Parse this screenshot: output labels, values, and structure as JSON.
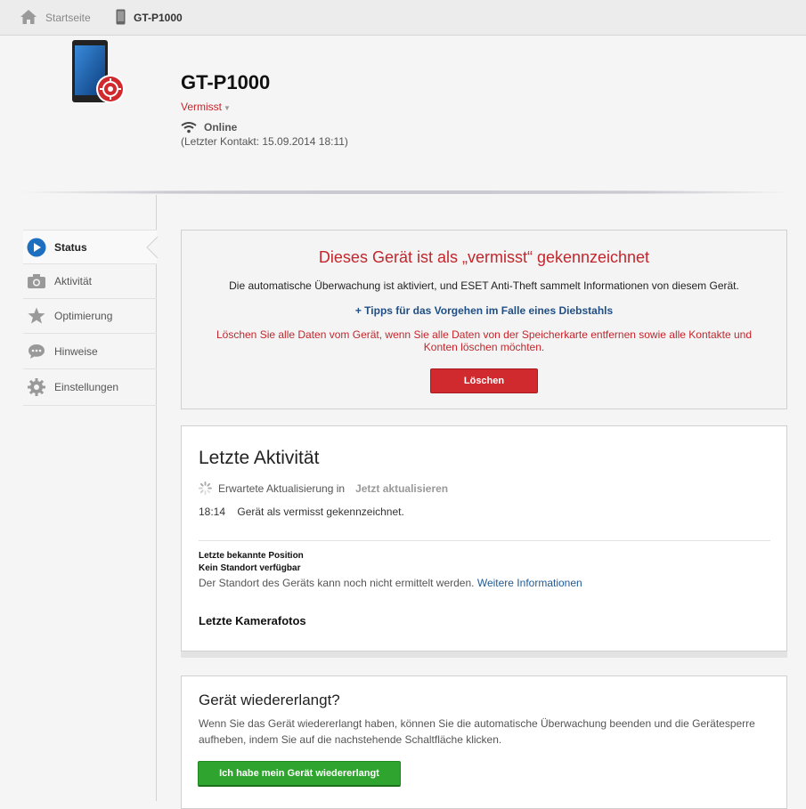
{
  "breadcrumb": {
    "home_label": "Startseite",
    "device_label": "GT-P1000"
  },
  "header": {
    "device_name": "GT-P1000",
    "status": "Vermisst",
    "connection": "Online",
    "last_contact": "(Letzter Kontakt: 15.09.2014 18:11)"
  },
  "sidebar": {
    "items": [
      {
        "label": "Status",
        "icon": "play-circle-icon"
      },
      {
        "label": "Aktivität",
        "icon": "camera-icon"
      },
      {
        "label": "Optimierung",
        "icon": "star-icon"
      },
      {
        "label": "Hinweise",
        "icon": "chat-bubble-icon"
      },
      {
        "label": "Einstellungen",
        "icon": "gear-icon"
      }
    ]
  },
  "alert": {
    "title": "Dieses Gerät ist als „vermisst“ gekennzeichnet",
    "description": "Die automatische Überwachung ist aktiviert, und ESET Anti-Theft sammelt Informationen von diesem Gerät.",
    "tips_link": "+ Tipps für das Vorgehen im Falle eines Diebstahls",
    "warning": "Löschen Sie alle Daten vom Gerät, wenn Sie alle Daten von der Speicherkarte entfernen sowie alle Kontakte und Konten löschen möchten.",
    "delete_button": "Löschen"
  },
  "activity": {
    "title": "Letzte Aktivität",
    "refresh_text": "Erwartete Aktualisierung in",
    "refresh_link": "Jetzt aktualisieren",
    "entries": [
      {
        "time": "18:14",
        "text": "Gerät als vermisst gekennzeichnet."
      }
    ],
    "position_label": "Letzte bekannte Position",
    "position_status": "Kein Standort verfügbar",
    "position_desc": "Der Standort des Geräts kann noch nicht ermittelt werden.",
    "more_info_link": "Weitere Informationen",
    "camera_title": "Letzte Kamerafotos"
  },
  "recover": {
    "title": "Gerät wiedererlangt?",
    "description": "Wenn Sie das Gerät wiedererlangt haben, können Sie die automatische Überwachung beenden und die Gerätesperre aufheben, indem Sie auf die nachstehende Schaltfläche klicken.",
    "button": "Ich habe mein Gerät wiedererlangt"
  },
  "colors": {
    "alert_red": "#c3262c",
    "accent_blue": "#1f6fc0",
    "success_green": "#2fa52f"
  }
}
